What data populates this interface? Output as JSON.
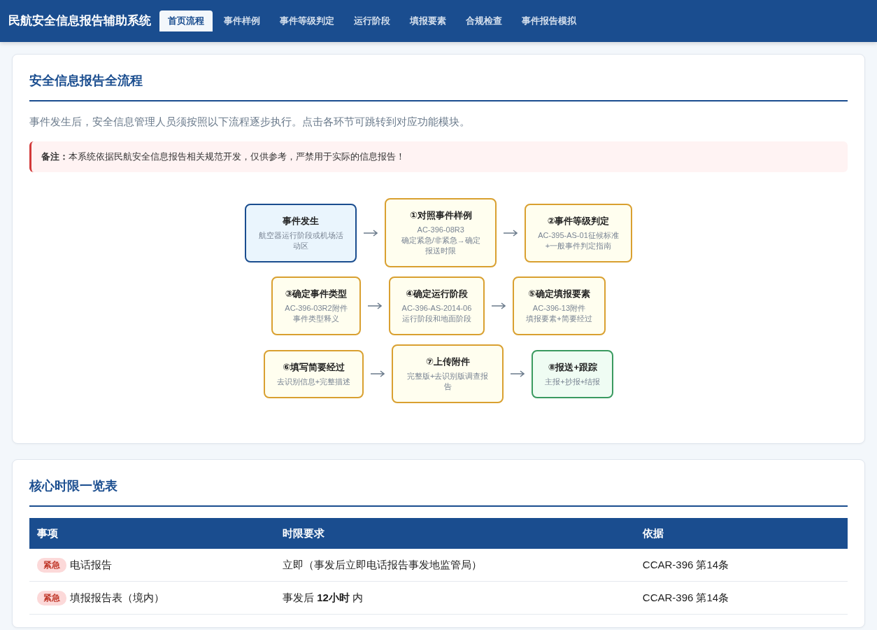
{
  "navbar": {
    "brand": "民航安全信息报告辅助系统",
    "tabs": [
      {
        "label": "首页流程",
        "selected": true
      },
      {
        "label": "事件样例",
        "selected": false
      },
      {
        "label": "事件等级判定",
        "selected": false
      },
      {
        "label": "运行阶段",
        "selected": false
      },
      {
        "label": "填报要素",
        "selected": false
      },
      {
        "label": "合规检查",
        "selected": false
      },
      {
        "label": "事件报告模拟",
        "selected": false
      }
    ]
  },
  "flow_card": {
    "title": "安全信息报告全流程",
    "description": "事件发生后，安全信息管理人员须按照以下流程逐步执行。点击各环节可跳转到对应功能模块。",
    "note": "**备注：**本系统依据民航安全信息报告相关规范开发，仅供参考，严禁用于实际的信息报告！",
    "flow_rows": [
      [
        {
          "kind": "start",
          "title": "事件发生",
          "lines": [
            "航空器运行阶段或机场活动区"
          ]
        },
        {
          "kind": "step",
          "title": "①对照事件样例",
          "lines": [
            "AC-396-08R3",
            "确定紧急/非紧急→确定报送时限"
          ]
        },
        {
          "kind": "step",
          "title": "②事件等级判定",
          "lines": [
            "AC-395-AS-01征候标准",
            "+一般事件判定指南"
          ]
        }
      ],
      [
        {
          "kind": "step",
          "title": "③确定事件类型",
          "lines": [
            "AC-396-03R2附件",
            "事件类型释义"
          ]
        },
        {
          "kind": "step",
          "title": "④确定运行阶段",
          "lines": [
            "AC-396-AS-2014-06",
            "运行阶段和地面阶段"
          ]
        },
        {
          "kind": "step",
          "title": "⑤确定填报要素",
          "lines": [
            "AC-396-13附件",
            "填报要素+简要经过"
          ]
        }
      ],
      [
        {
          "kind": "step",
          "title": "⑥填写简要经过",
          "lines": [
            "去识别信息+完整描述"
          ]
        },
        {
          "kind": "step",
          "title": "⑦上传附件",
          "lines": [
            "完整版+去识别版调查报告"
          ]
        },
        {
          "kind": "end",
          "title": "⑧报送+跟踪",
          "lines": [
            "主报+抄报+结报"
          ]
        }
      ]
    ]
  },
  "deadline_card": {
    "title": "核心时限一览表",
    "table": {
      "columns": [
        "事项",
        "时限要求",
        "依据"
      ],
      "rows": [
        {
          "tag": "紧急",
          "item": "电话报告",
          "requirement": "立即（事发后立即电话报告事发地监管局）",
          "basis": "CCAR-396 第14条"
        },
        {
          "tag": "紧急",
          "item": "填报报告表（境内）",
          "requirement": "事发后 **12小时** 内",
          "basis": "CCAR-396 第14条"
        }
      ]
    }
  }
}
